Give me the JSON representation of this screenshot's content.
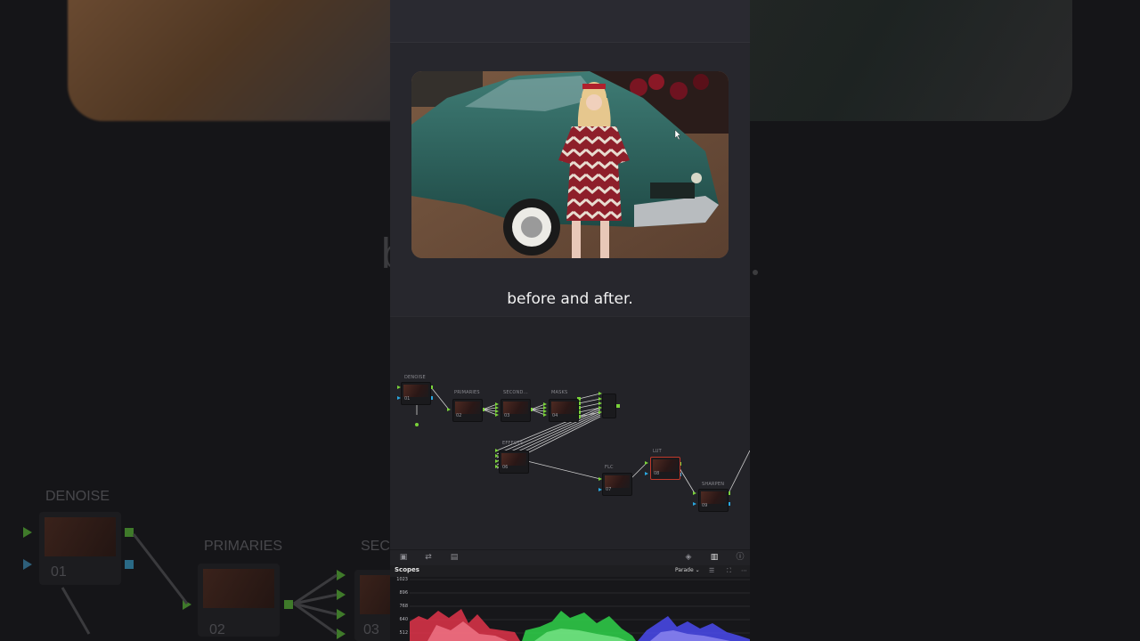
{
  "caption": "before and after.",
  "background": {
    "ghost_text": "b",
    "nodes": [
      {
        "label": "DENOISE",
        "number": "01"
      },
      {
        "label": "PRIMARIES",
        "number": "02"
      },
      {
        "label": "SECO",
        "number": "03"
      }
    ]
  },
  "node_graph": {
    "nodes": [
      {
        "label": "DENOISE",
        "number": "01"
      },
      {
        "label": "PRIMARIES",
        "number": "02"
      },
      {
        "label": "SECOND...",
        "number": "03"
      },
      {
        "label": "MASKS",
        "number": "04"
      },
      {
        "label": "EFFECTS",
        "number": "06"
      },
      {
        "label": "FLC",
        "number": "07"
      },
      {
        "label": "LUT",
        "number": "08"
      },
      {
        "label": "SHARPEN",
        "number": "09"
      }
    ]
  },
  "scopes": {
    "title": "Scopes",
    "mode": "Parade",
    "scale": [
      "1023",
      "896",
      "768",
      "640",
      "512"
    ]
  },
  "colors": {
    "panel": "#27272d",
    "node_link": "#c8c8c8",
    "port_green": "#7ad23a",
    "port_blue": "#2aa8e0",
    "lut_outline": "#c0392b"
  }
}
